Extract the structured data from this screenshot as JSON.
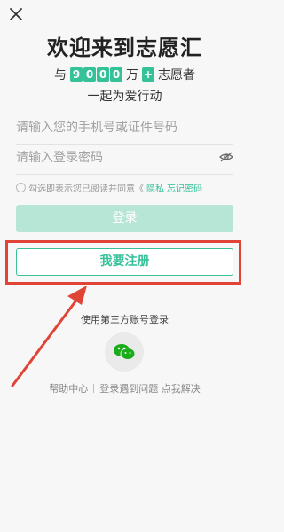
{
  "header": {
    "title": "欢迎来到志愿汇",
    "count_prefix": "与",
    "count_digits": [
      "9",
      "0",
      "0",
      "0"
    ],
    "count_unit": "万",
    "count_plus": "+",
    "count_suffix": "志愿者",
    "subtitle": "一起为爱行动"
  },
  "form": {
    "phone_placeholder": "请输入您的手机号或证件号码",
    "password_placeholder": "请输入登录密码",
    "agreement_text": "勾选即表示您已阅读并同意《",
    "agreement_link": "隐私",
    "forgot_link": "忘记密码",
    "login_label": "登录",
    "register_label": "我要注册"
  },
  "third_party": {
    "label": "使用第三方账号登录",
    "wechat_icon": "wechat-icon"
  },
  "footer": {
    "help": "帮助中心",
    "problem": "登录遇到问题 点我解决"
  },
  "colors": {
    "accent": "#35c299",
    "login_disabled": "#b8e6d6",
    "annotation": "#e04436"
  }
}
